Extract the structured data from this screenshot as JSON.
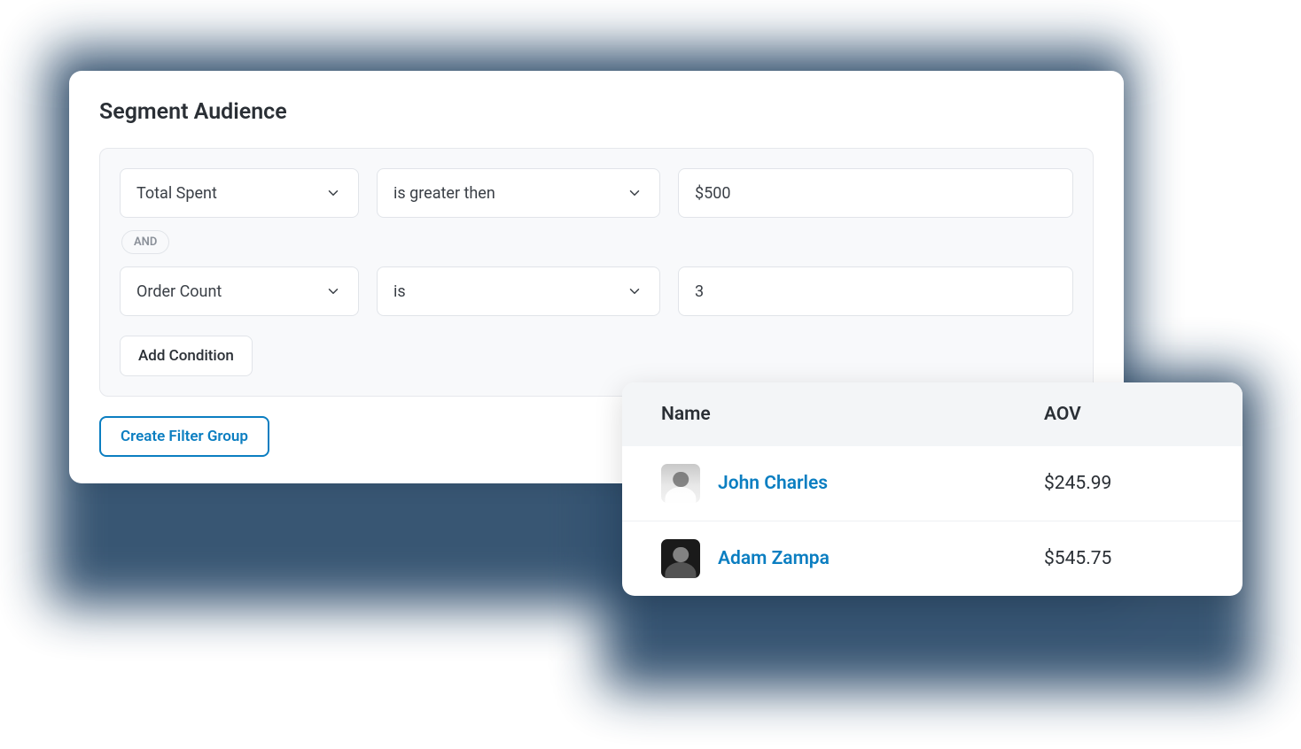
{
  "segment": {
    "title": "Segment Audience",
    "conditions": [
      {
        "field": "Total Spent",
        "operator": "is greater then",
        "value": "$500"
      },
      {
        "field": "Order Count",
        "operator": "is",
        "value": "3"
      }
    ],
    "joiner": "AND",
    "add_condition_label": "Add Condition",
    "create_filter_label": "Create Filter Group"
  },
  "results": {
    "columns": {
      "name": "Name",
      "aov": "AOV"
    },
    "rows": [
      {
        "name": "John Charles",
        "aov": "$245.99"
      },
      {
        "name": "Adam Zampa",
        "aov": "$545.75"
      }
    ]
  },
  "colors": {
    "accent": "#0b7ec1",
    "backdrop": "#2e4d6c"
  }
}
